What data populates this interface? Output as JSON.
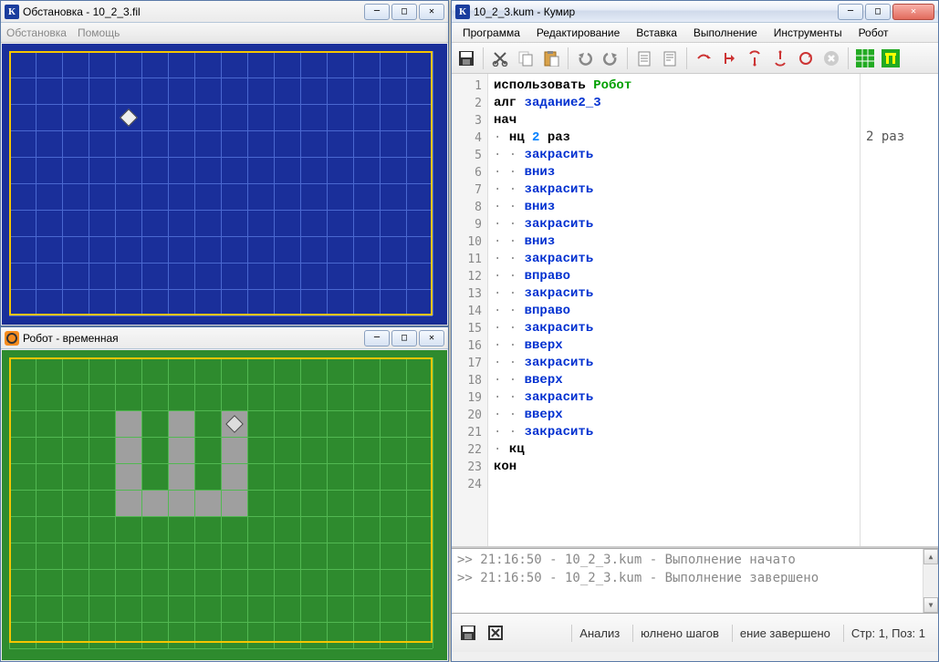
{
  "obst": {
    "title": "Обстановка - 10_2_3.fil",
    "menu": [
      "Обстановка",
      "Помощь"
    ]
  },
  "robot_temp": {
    "title": "Робот - временная"
  },
  "kumir": {
    "title": "10_2_3.kum - Кумир",
    "menu": [
      "Программа",
      "Редактирование",
      "Вставка",
      "Выполнение",
      "Инструменты",
      "Робот"
    ],
    "code": [
      {
        "n": 1,
        "segs": [
          {
            "t": "использовать ",
            "c": "kw"
          },
          {
            "t": "Робот",
            "c": "ident-green"
          }
        ]
      },
      {
        "n": 2,
        "segs": [
          {
            "t": "алг ",
            "c": "kw"
          },
          {
            "t": "задание2_3",
            "c": "ident-blue"
          }
        ]
      },
      {
        "n": 3,
        "segs": [
          {
            "t": "нач",
            "c": "kw"
          }
        ]
      },
      {
        "n": 4,
        "indent": 1,
        "segs": [
          {
            "t": "нц ",
            "c": "kw"
          },
          {
            "t": "2",
            "c": "num"
          },
          {
            "t": " раз",
            "c": "kw"
          }
        ]
      },
      {
        "n": 5,
        "indent": 2,
        "segs": [
          {
            "t": "закрасить",
            "c": "ident-blue"
          }
        ]
      },
      {
        "n": 6,
        "indent": 2,
        "segs": [
          {
            "t": "вниз",
            "c": "ident-blue"
          }
        ]
      },
      {
        "n": 7,
        "indent": 2,
        "segs": [
          {
            "t": "закрасить",
            "c": "ident-blue"
          }
        ]
      },
      {
        "n": 8,
        "indent": 2,
        "segs": [
          {
            "t": "вниз",
            "c": "ident-blue"
          }
        ]
      },
      {
        "n": 9,
        "indent": 2,
        "segs": [
          {
            "t": "закрасить",
            "c": "ident-blue"
          }
        ]
      },
      {
        "n": 10,
        "indent": 2,
        "segs": [
          {
            "t": "вниз",
            "c": "ident-blue"
          }
        ]
      },
      {
        "n": 11,
        "indent": 2,
        "segs": [
          {
            "t": "закрасить",
            "c": "ident-blue"
          }
        ]
      },
      {
        "n": 12,
        "indent": 2,
        "segs": [
          {
            "t": "вправо",
            "c": "ident-blue"
          }
        ]
      },
      {
        "n": 13,
        "indent": 2,
        "segs": [
          {
            "t": "закрасить",
            "c": "ident-blue"
          }
        ]
      },
      {
        "n": 14,
        "indent": 2,
        "segs": [
          {
            "t": "вправо",
            "c": "ident-blue"
          }
        ]
      },
      {
        "n": 15,
        "indent": 2,
        "segs": [
          {
            "t": "закрасить",
            "c": "ident-blue"
          }
        ]
      },
      {
        "n": 16,
        "indent": 2,
        "segs": [
          {
            "t": "вверх",
            "c": "ident-blue"
          }
        ]
      },
      {
        "n": 17,
        "indent": 2,
        "segs": [
          {
            "t": "закрасить",
            "c": "ident-blue"
          }
        ]
      },
      {
        "n": 18,
        "indent": 2,
        "segs": [
          {
            "t": "вверх",
            "c": "ident-blue"
          }
        ]
      },
      {
        "n": 19,
        "indent": 2,
        "segs": [
          {
            "t": "закрасить",
            "c": "ident-blue"
          }
        ]
      },
      {
        "n": 20,
        "indent": 2,
        "segs": [
          {
            "t": "вверх",
            "c": "ident-blue"
          }
        ]
      },
      {
        "n": 21,
        "indent": 2,
        "segs": [
          {
            "t": "закрасить",
            "c": "ident-blue"
          }
        ]
      },
      {
        "n": 22,
        "indent": 1,
        "segs": [
          {
            "t": "кц",
            "c": "kw"
          }
        ]
      },
      {
        "n": 23,
        "segs": [
          {
            "t": "кон",
            "c": "kw"
          }
        ]
      },
      {
        "n": 24,
        "segs": []
      }
    ],
    "side_msg": "2 раз",
    "console": [
      ">> 21:16:50 - 10_2_3.kum - Выполнение начато",
      ">> 21:16:50 - 10_2_3.kum - Выполнение завершено"
    ],
    "status": {
      "analysis": "Анализ",
      "steps": "юлнено шагов",
      "done": "ение завершено",
      "pos": "Стр: 1, Поз: 1"
    }
  }
}
